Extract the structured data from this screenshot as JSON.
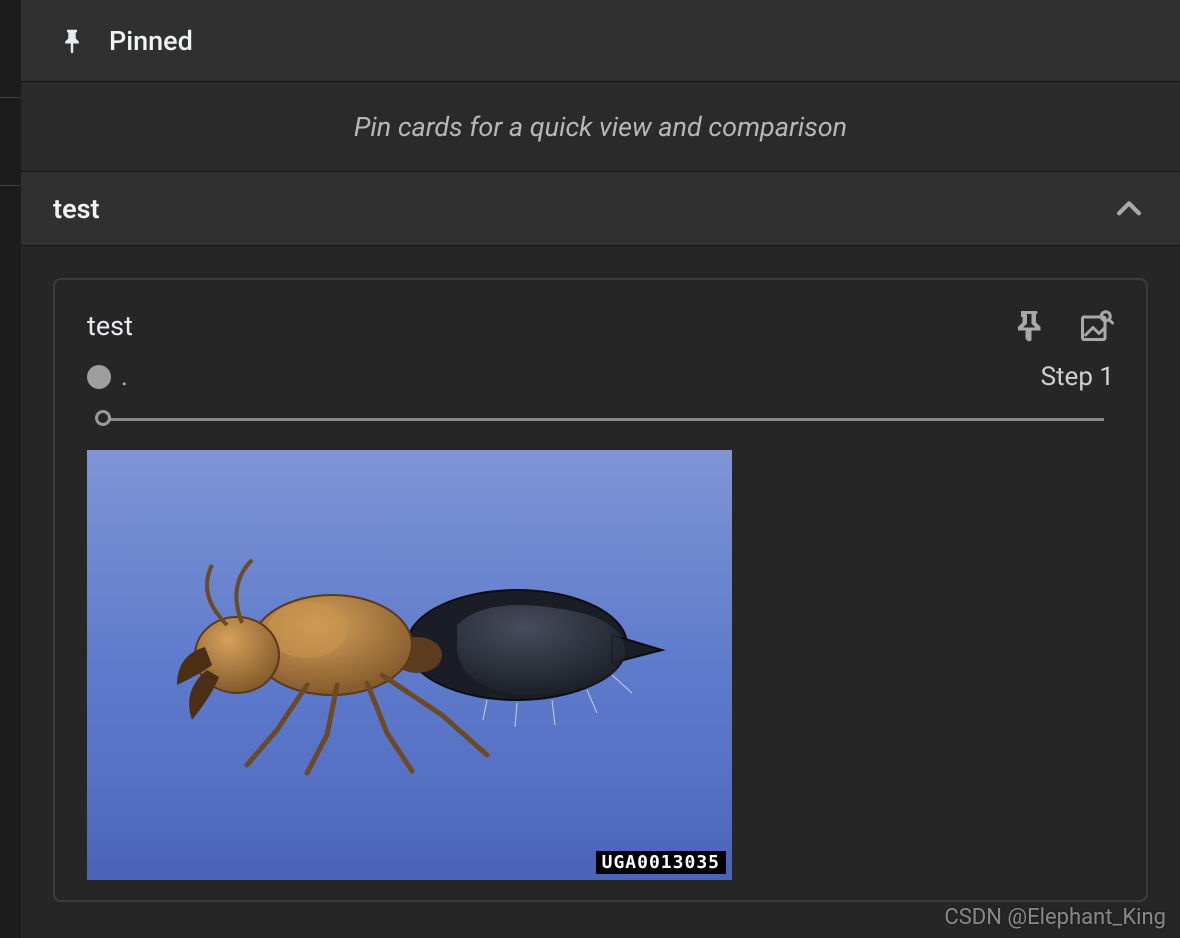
{
  "pinned": {
    "title": "Pinned",
    "hint": "Pin cards for a quick view and comparison"
  },
  "section": {
    "title": "test"
  },
  "card": {
    "title": "test",
    "run_label": ".",
    "step_label": "Step 1",
    "image_id": "UGA0013035"
  },
  "watermark": "CSDN @Elephant_King"
}
